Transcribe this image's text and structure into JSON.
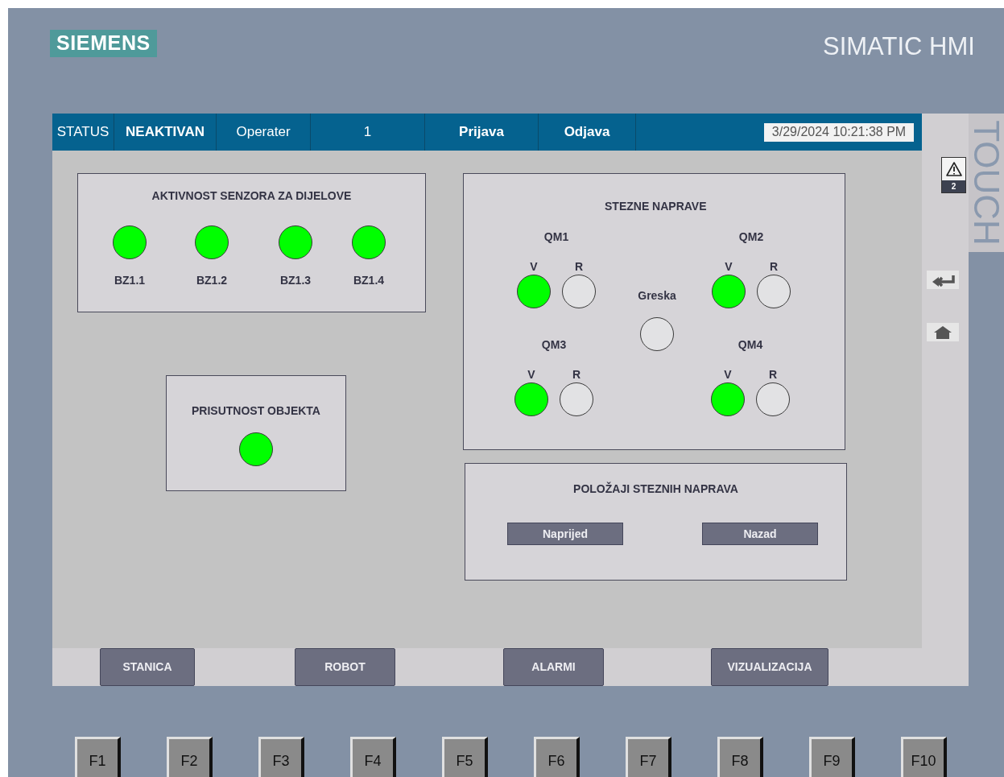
{
  "brand": {
    "logo": "SIEMENS",
    "product": "SIMATIC HMI",
    "touch": "TOUCH"
  },
  "status_bar": {
    "cells": [
      {
        "kind": "label",
        "text": "STATUS"
      },
      {
        "kind": "value",
        "text": "NEAKTIVAN"
      },
      {
        "kind": "label",
        "text": "Operater"
      },
      {
        "kind": "plain",
        "text": "1"
      },
      {
        "kind": "button",
        "text": "Prijava"
      },
      {
        "kind": "button",
        "text": "Odjava"
      }
    ],
    "datetime": "3/29/2024 10:21:38 PM"
  },
  "alarm_indicator": {
    "count": "2"
  },
  "sensors_panel": {
    "title": "AKTIVNOST SENZORA ZA DIJELOVE",
    "sensors": [
      {
        "label": "BZ1.1",
        "on": true
      },
      {
        "label": "BZ1.2",
        "on": true
      },
      {
        "label": "BZ1.3",
        "on": true
      },
      {
        "label": "BZ1.4",
        "on": true
      }
    ]
  },
  "presence_panel": {
    "title": "PRISUTNOST OBJEKTA",
    "on": true
  },
  "clamps_panel": {
    "title": "STEZNE NAPRAVE",
    "clamps": [
      {
        "name": "QM1",
        "lamps": [
          {
            "label": "V",
            "on": true
          },
          {
            "label": "R",
            "on": false
          }
        ]
      },
      {
        "name": "QM2",
        "lamps": [
          {
            "label": "V",
            "on": true
          },
          {
            "label": "R",
            "on": false
          }
        ]
      },
      {
        "name": "QM3",
        "lamps": [
          {
            "label": "V",
            "on": true
          },
          {
            "label": "R",
            "on": false
          }
        ]
      },
      {
        "name": "QM4",
        "lamps": [
          {
            "label": "V",
            "on": true
          },
          {
            "label": "R",
            "on": false
          }
        ]
      }
    ],
    "error": {
      "label": "Greska",
      "on": false
    }
  },
  "positions_panel": {
    "title": "POLOŽAJI STEZNIH NAPRAVA",
    "buttons": [
      "Naprijed",
      "Nazad"
    ]
  },
  "nav_buttons": [
    "STANICA",
    "ROBOT",
    "ALARMI",
    "VIZUALIZACIJA"
  ],
  "function_keys": [
    "F1",
    "F2",
    "F3",
    "F4",
    "F5",
    "F6",
    "F7",
    "F8",
    "F9",
    "F10"
  ]
}
